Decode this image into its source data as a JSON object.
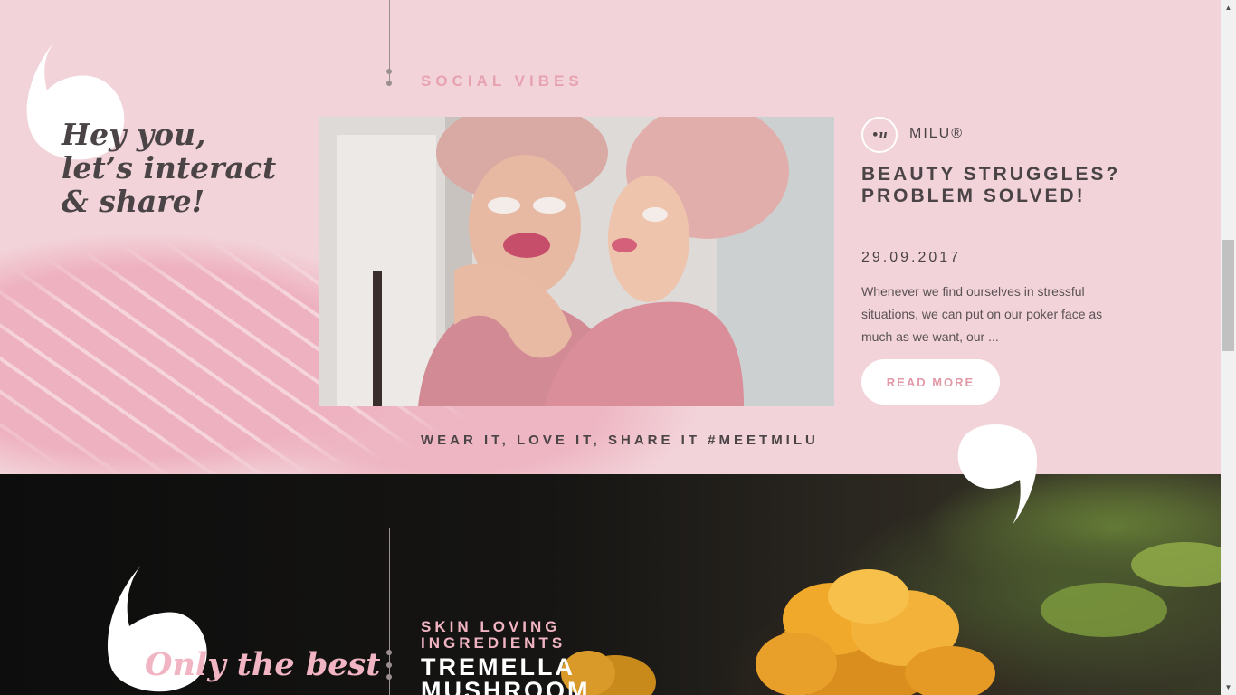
{
  "social": {
    "section_label": "SOCIAL VIBES",
    "headline_line1": "Hey you,",
    "headline_line2": "let’s interact",
    "headline_line3": "& share!",
    "post": {
      "author": "MILU®",
      "avatar_text": "•u",
      "title": "BEAUTY STRUGGLES? PROBLEM SOLVED!",
      "date": "29.09.2017",
      "excerpt": "Whenever we find ourselves in stressful situations, we can put on our poker face as much as we want, our ...",
      "read_more": "READ MORE",
      "image_alt": "Two smiling women with towel turbans and under-eye patches"
    },
    "tagline": "WEAR IT, LOVE IT, SHARE IT #MEETMILU"
  },
  "ingredients": {
    "headline": "Only the best",
    "label_line1": "SKIN LOVING",
    "label_line2": "INGREDIENTS",
    "name_line1": "TREMELLA",
    "name_line2": "MUSHROOM"
  },
  "colors": {
    "pink_bg": "#f2d3d9",
    "accent_pink": "#e7a2b0",
    "dark_text": "#4b4446",
    "dark_section": "#131311"
  },
  "icons": {
    "quote_mark": "quote-mark-icon",
    "scroll_up": "▲",
    "scroll_down": "▼"
  }
}
